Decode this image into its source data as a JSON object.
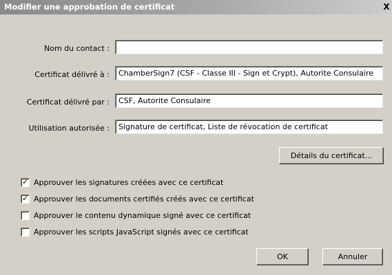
{
  "window": {
    "title": "Modifier une approbation de certificat",
    "close_glyph": "X"
  },
  "fields": [
    {
      "label": "Nom du contact :",
      "value": ""
    },
    {
      "label": "Certificat délivré à :",
      "value": "ChamberSign7 (CSF - Classe III - Sign et Crypt), Autorite Consulaire"
    },
    {
      "label": "Certificat délivré par :",
      "value": "CSF, Autorite Consulaire"
    },
    {
      "label": "Utilisation autorisée :",
      "value": "Signature de certificat, Liste de révocation de certificat"
    }
  ],
  "details_button": "Détails du certificat...",
  "checkboxes": [
    {
      "label": "Approuver les signatures créées avec ce certificat",
      "checked": true
    },
    {
      "label": "Approuver les documents certifiés créés avec ce certificat",
      "checked": true
    },
    {
      "label": "Approuver le contenu  dynamique signé avec ce certificat",
      "checked": false
    },
    {
      "label": "Approuver les scripts JavaScript signés avec ce certificat",
      "checked": false
    }
  ],
  "ok_button": "OK",
  "cancel_button": "Annuler"
}
